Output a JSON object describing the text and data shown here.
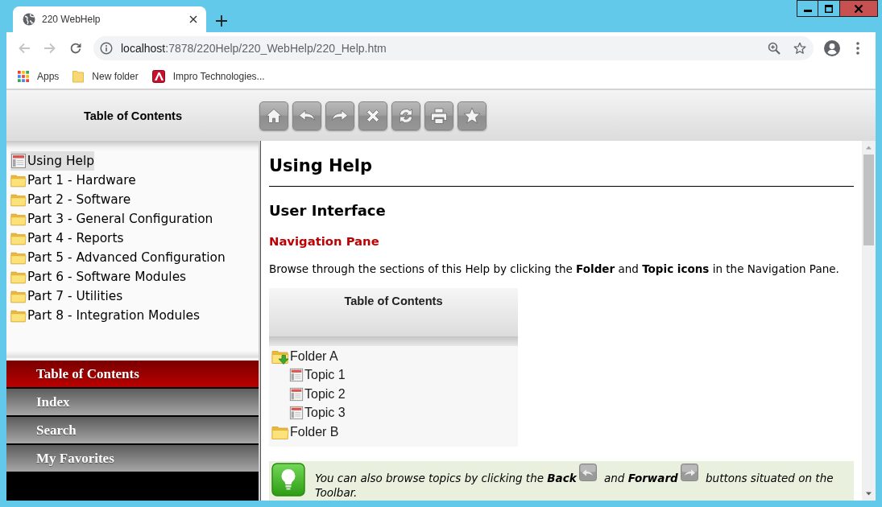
{
  "browser": {
    "tab_title": "220 WebHelp",
    "back": {
      "disabled": true
    },
    "forward": {
      "disabled": true
    },
    "address": {
      "host": "localhost",
      "path": ":7878/220Help/220_WebHelp/220_Help.htm"
    },
    "bookmarks": [
      {
        "label": "Apps",
        "kind": "apps"
      },
      {
        "label": "New folder",
        "kind": "folder"
      },
      {
        "label": "Impro Technologies...",
        "kind": "site"
      }
    ]
  },
  "toolbar": {
    "title": "Table of Contents"
  },
  "toc": [
    {
      "label": "Using Help",
      "kind": "topic",
      "selected": true
    },
    {
      "label": "Part 1 - Hardware",
      "kind": "folder",
      "selected": false
    },
    {
      "label": "Part 2 - Software",
      "kind": "folder",
      "selected": false
    },
    {
      "label": "Part 3 - General Configuration",
      "kind": "folder",
      "selected": false
    },
    {
      "label": "Part 4 - Reports",
      "kind": "folder",
      "selected": false
    },
    {
      "label": "Part 5 - Advanced Configuration",
      "kind": "folder",
      "selected": false
    },
    {
      "label": "Part 6 - Software Modules",
      "kind": "folder",
      "selected": false
    },
    {
      "label": "Part 7 - Utilities",
      "kind": "folder",
      "selected": false
    },
    {
      "label": "Part 8 - Integration Modules",
      "kind": "folder",
      "selected": false
    }
  ],
  "nav_tabs": [
    {
      "label": "Table of Contents",
      "selected": true
    },
    {
      "label": "Index",
      "selected": false
    },
    {
      "label": "Search",
      "selected": false
    },
    {
      "label": "My Favorites",
      "selected": false
    }
  ],
  "content": {
    "title": "Using Help",
    "section": "User Interface",
    "subsection": "Navigation Pane",
    "paragraph": "Browse through the sections of this Help by clicking the **Folder** and **Topic icons** in the Navigation Pane.",
    "figure": {
      "header": "Table of Contents",
      "tree": [
        {
          "label": "Folder A",
          "kind": "folder",
          "expanded": true,
          "children": [
            {
              "label": "Topic 1",
              "kind": "topic"
            },
            {
              "label": "Topic 2",
              "kind": "topic"
            },
            {
              "label": "Topic 3",
              "kind": "topic"
            }
          ]
        },
        {
          "label": "Folder B",
          "kind": "folder",
          "expanded": false
        }
      ]
    },
    "tip": {
      "parts": [
        "You can also browse topics by clicking the **Back**",
        "and **Forward**",
        "buttons situated on the Toolbar."
      ]
    }
  }
}
